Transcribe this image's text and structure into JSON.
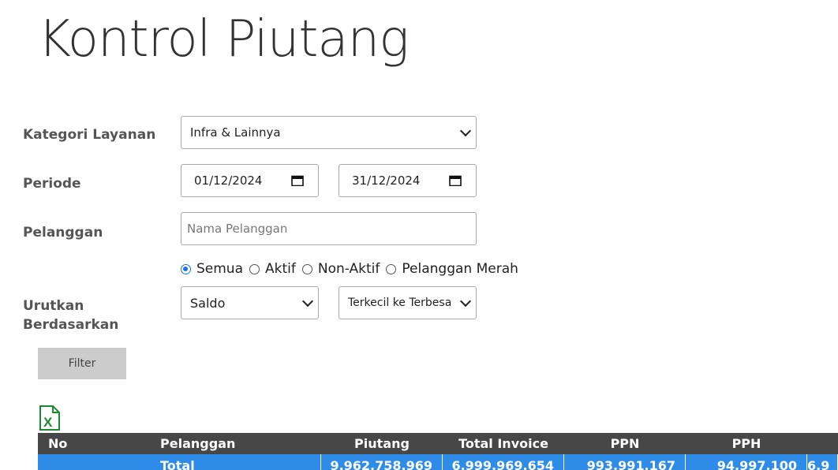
{
  "header": {
    "title": "Kontrol Piutang"
  },
  "form": {
    "kategori": {
      "label": "Kategori Layanan",
      "value": "Infra & Lainnya"
    },
    "periode": {
      "label": "Periode",
      "start": "01/12/2024",
      "end": "31/12/2024"
    },
    "pelanggan": {
      "label": "Pelanggan",
      "placeholder": "Nama Pelanggan"
    },
    "status_options": [
      {
        "label": "Semua",
        "checked": true
      },
      {
        "label": "Aktif",
        "checked": false
      },
      {
        "label": "Non-Aktif",
        "checked": false
      },
      {
        "label": "Pelanggan Merah",
        "checked": false
      }
    ],
    "urutkan": {
      "label": "Urutkan Berdasarkan",
      "field": "Saldo",
      "order": "Terkecil ke Terbesa"
    },
    "filter_label": "Filter"
  },
  "table": {
    "columns": [
      "No",
      "Pelanggan",
      "Piutang",
      "Total Invoice",
      "PPN",
      "PPH"
    ],
    "total_row": {
      "pelanggan": "Total",
      "piutang": "9.962.758.969",
      "total_invoice": "6.999.969.654",
      "ppn": "993.991.167",
      "pph": "94.997.100",
      "more": "6.9"
    }
  },
  "colors": {
    "header_bg": "#474747",
    "total_row_bg": "#2e8be8",
    "radio_accent": "#1a73e8",
    "excel_green": "#1e8a2f"
  }
}
